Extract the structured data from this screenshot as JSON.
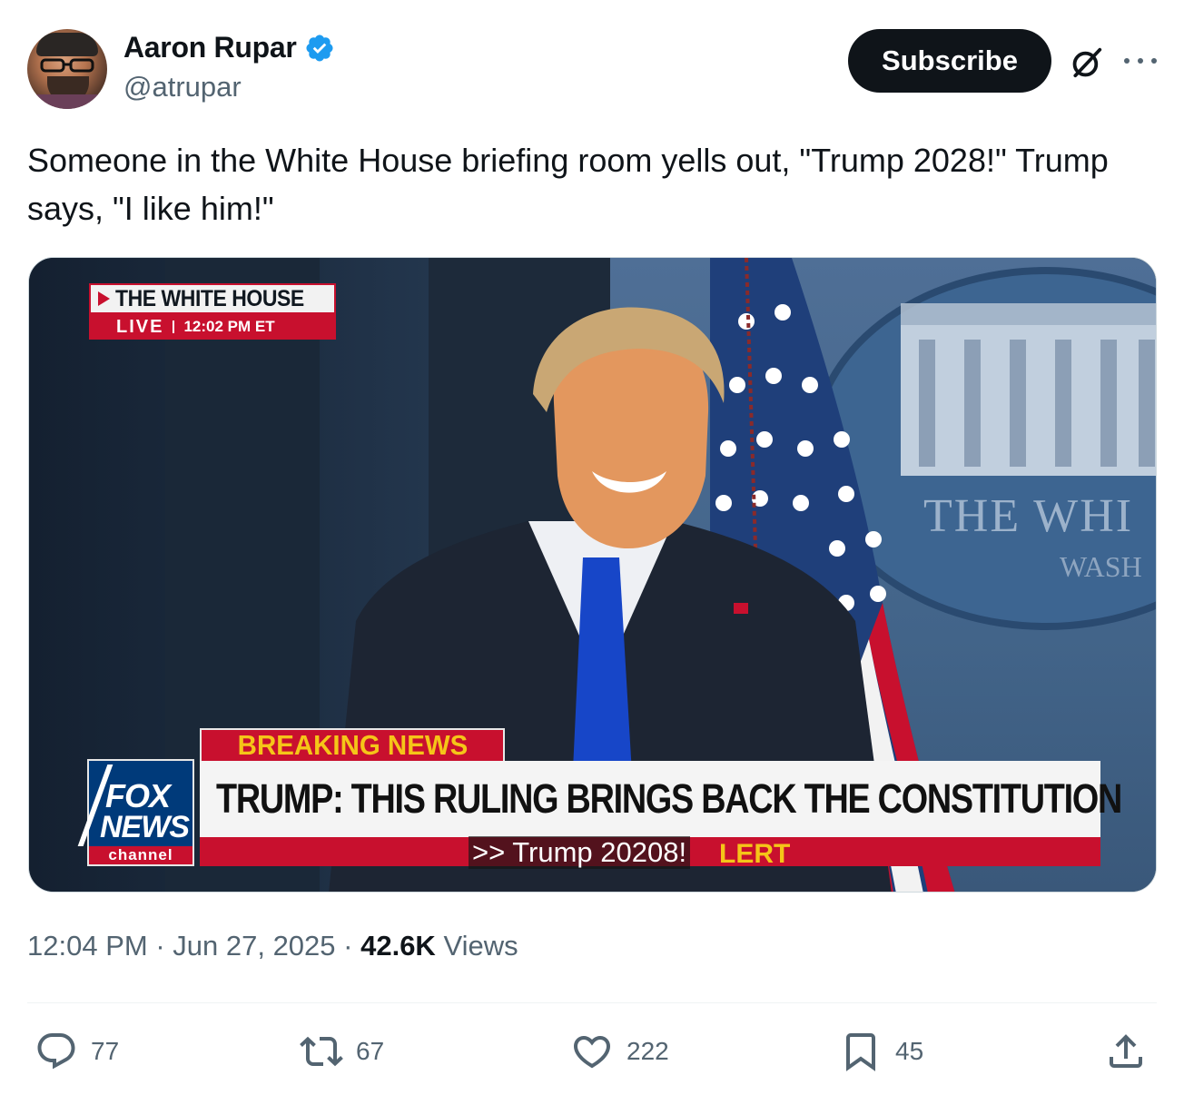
{
  "author": {
    "name": "Aaron Rupar",
    "handle": "@atrupar",
    "verified": true
  },
  "header_actions": {
    "subscribe_label": "Subscribe"
  },
  "tweet": {
    "text": "Someone in the White House briefing room yells out, \"Trump 2028!\" Trump says, \"I like him!\""
  },
  "video": {
    "live_title": "THE WHITE HOUSE",
    "live_label": "LIVE",
    "live_time": "12:02 PM ET",
    "breaking_label": "BREAKING NEWS",
    "headline": "TRUMP: THIS RULING BRINGS BACK THE CONSTITUTION",
    "alert_word": "LERT",
    "caption": ">> Trump 20208!",
    "logo_fox": "FOX",
    "logo_news": "NEWS",
    "logo_channel": "channel",
    "background_text": "THE WHI",
    "background_subtext": "WASH"
  },
  "meta": {
    "time": "12:04 PM",
    "date": "Jun 27, 2025",
    "views_count": "42.6K",
    "views_label": "Views"
  },
  "actions": {
    "replies": "77",
    "reposts": "67",
    "likes": "222",
    "bookmarks": "45"
  },
  "colors": {
    "verified_badge": "#1d9bf0",
    "subscribe_bg": "#0f1419",
    "secondary_text": "#536471",
    "fox_red": "#c8102e",
    "fox_yellow": "#f5c518"
  },
  "icons": [
    "verified-badge-icon",
    "grok-icon",
    "more-icon",
    "reply-icon",
    "repost-icon",
    "like-icon",
    "bookmark-icon",
    "share-icon"
  ]
}
